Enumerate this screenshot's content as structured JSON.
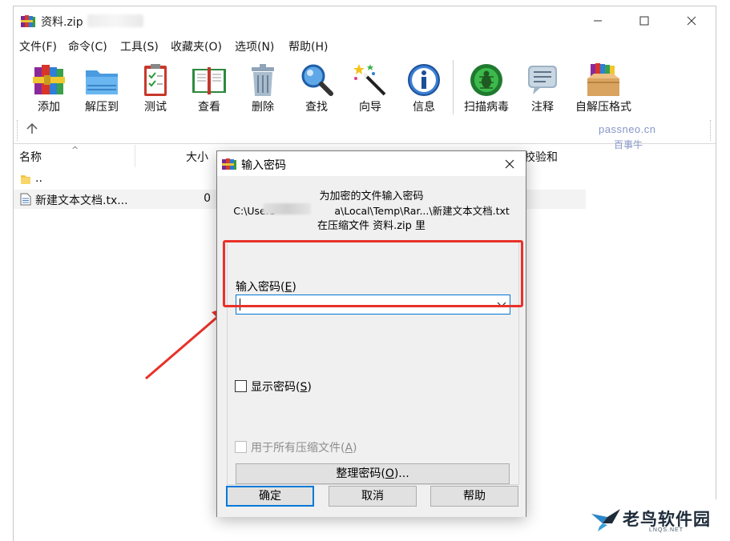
{
  "window": {
    "title": "资料.zip",
    "controls": {
      "minimize_icon": "minimize-icon",
      "maximize_icon": "maximize-icon",
      "close_icon": "close-icon"
    }
  },
  "menubar": [
    {
      "label": "文件(F)"
    },
    {
      "label": "命令(C)"
    },
    {
      "label": "工具(S)"
    },
    {
      "label": "收藏夹(O)"
    },
    {
      "label": "选项(N)"
    },
    {
      "label": "帮助(H)"
    }
  ],
  "toolbar": [
    {
      "label": "添加",
      "icon": "add-books-icon"
    },
    {
      "label": "解压到",
      "icon": "extract-folder-icon"
    },
    {
      "label": "测试",
      "icon": "test-clipboard-icon"
    },
    {
      "label": "查看",
      "icon": "view-book-icon"
    },
    {
      "label": "删除",
      "icon": "trash-icon"
    },
    {
      "label": "查找",
      "icon": "magnifier-icon"
    },
    {
      "label": "向导",
      "icon": "wizard-wand-icon"
    },
    {
      "label": "信息",
      "icon": "info-icon"
    },
    {
      "label": "扫描病毒",
      "icon": "virus-scan-icon"
    },
    {
      "label": "注释",
      "icon": "comment-icon"
    },
    {
      "label": "自解压格式",
      "icon": "sfx-box-icon"
    }
  ],
  "watermark": {
    "line1": "passneo.cn",
    "line2": "百事牛"
  },
  "filelist": {
    "columns": {
      "name": "名称",
      "size": "大小",
      "checksum": "校验和"
    },
    "rows": [
      {
        "name": "..",
        "size": ""
      },
      {
        "name": "新建文本文档.tx...",
        "size": "0"
      }
    ]
  },
  "dialog": {
    "title": "输入密码",
    "info_line1": "为加密的文件输入密码",
    "info_line2_prefix": "C:\\Users",
    "info_line2_suffix": "a\\Local\\Temp\\Rar...\\新建文本文档.txt",
    "info_line3": "在压缩文件 资料.zip 里",
    "password_label": "输入密码(",
    "password_label_key": "E",
    "password_label_end": ")",
    "password_value": "",
    "show_password_label": "显示密码(",
    "show_password_key": "S",
    "show_password_end": ")",
    "show_password_checked": false,
    "use_for_all_label": "用于所有压缩文件(",
    "use_for_all_key": "A",
    "use_for_all_end": ")",
    "use_for_all_checked": false,
    "organize_label": "整理密码(",
    "organize_key": "O",
    "organize_end": ")...",
    "ok_label": "确定",
    "cancel_label": "取消",
    "help_label": "帮助"
  },
  "brand": {
    "name": "老鸟软件园",
    "sub": "LNQS.NET"
  },
  "colors": {
    "highlight": "#e8312a",
    "focus": "#0078d7",
    "watermark": "#8696c8"
  }
}
